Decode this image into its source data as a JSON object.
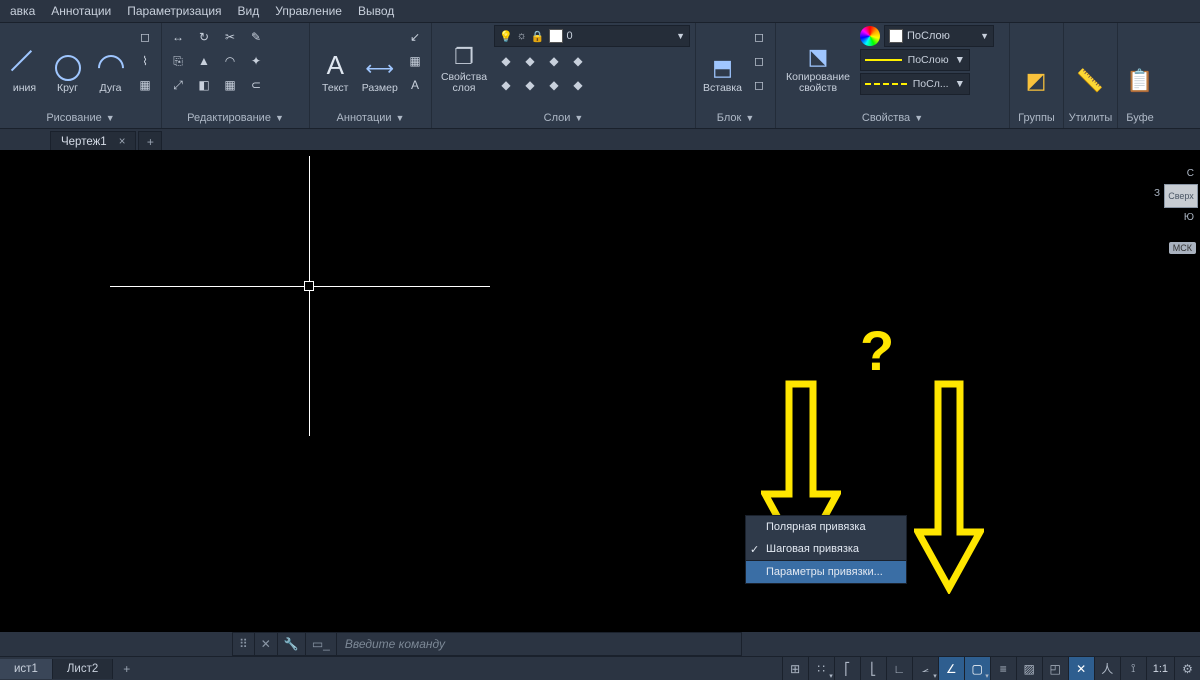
{
  "menu": [
    "авка",
    "Аннотации",
    "Параметризация",
    "Вид",
    "Управление",
    "Вывод"
  ],
  "ribbon": {
    "draw": {
      "title": "Рисование",
      "line": "иния",
      "circle": "Круг",
      "arc": "Дуга"
    },
    "edit": {
      "title": "Редактирование"
    },
    "anno": {
      "title": "Аннотации",
      "text": "Текст",
      "dim": "Размер"
    },
    "layers": {
      "title": "Слои",
      "props": "Свойства\nслоя",
      "current": "0"
    },
    "block": {
      "title": "Блок",
      "insert": "Вставка"
    },
    "props": {
      "title": "Свойства",
      "copy": "Копирование\nсвойств",
      "bylayer": "ПоСлою",
      "bylayer2": "ПоСлою",
      "bylayer3": "ПоСл..."
    },
    "groups": {
      "title": "Группы"
    },
    "util": {
      "title": "Утилиты"
    },
    "clip": {
      "title": "Буфе"
    }
  },
  "tab": {
    "name": "Чертеж1",
    "plus": "+",
    "close": "×"
  },
  "viewcube": {
    "top": "Сверх",
    "n": "С",
    "s": "Ю",
    "w": "З",
    "msk": "МСК"
  },
  "question": "?",
  "ctx": {
    "polar": "Полярная привязка",
    "grid": "Шаговая привязка",
    "settings": "Параметры привязки..."
  },
  "cmd": {
    "placeholder": "Введите  команду"
  },
  "sheets": {
    "s1": "ист1",
    "s2": "Лист2",
    "plus": "+"
  },
  "status": {
    "scale": "1:1"
  }
}
